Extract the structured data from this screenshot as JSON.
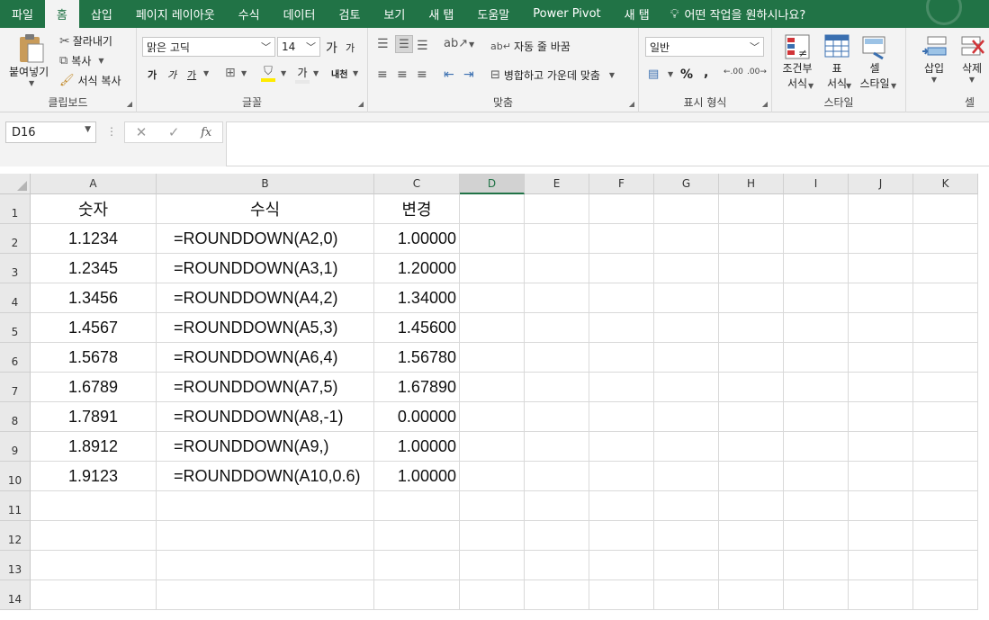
{
  "menu": {
    "tabs": [
      "파일",
      "홈",
      "삽입",
      "페이지 레이아웃",
      "수식",
      "데이터",
      "검토",
      "보기",
      "새 탭",
      "도움말",
      "Power Pivot",
      "새 탭"
    ],
    "active_index": 1,
    "tell_me": "어떤 작업을 원하시나요?"
  },
  "ribbon": {
    "clipboard": {
      "paste": "붙여넣기",
      "cut": "잘라내기",
      "copy": "복사",
      "format_painter": "서식 복사",
      "label": "클립보드"
    },
    "font": {
      "font_name": "맑은 고딕",
      "font_size": "14",
      "bold": "가",
      "italic": "가",
      "underline": "가",
      "font_color_glyph": "가",
      "phonetic": "내천",
      "grow": "가",
      "shrink": "가",
      "label": "글꼴"
    },
    "alignment": {
      "wrap_text": "자동 줄 바꿈",
      "merge_center": "병합하고 가운데 맞춤",
      "label": "맞춤"
    },
    "number": {
      "format": "일반",
      "percent": "%",
      "comma": ",",
      "label": "표시 형식"
    },
    "styles": {
      "conditional_line1": "조건부",
      "conditional_line2": "서식",
      "table_line1": "표",
      "table_line2": "서식",
      "cell_style_line1": "셀",
      "cell_style_line2": "스타일",
      "label": "스타일"
    },
    "cells": {
      "insert": "삽입",
      "delete": "삭제",
      "label": "셀"
    }
  },
  "formula_bar": {
    "name_box": "D16",
    "cancel": "✕",
    "enter": "✓",
    "fx": "fx",
    "formula": ""
  },
  "sheet": {
    "columns": [
      "A",
      "B",
      "C",
      "D",
      "E",
      "F",
      "G",
      "H",
      "I",
      "J",
      "K"
    ],
    "selected_column": "D",
    "row_numbers": [
      "1",
      "2",
      "3",
      "4",
      "5",
      "6",
      "7",
      "8",
      "9",
      "10",
      "11",
      "12",
      "13",
      "14"
    ],
    "header_row": [
      "숫자",
      "수식",
      "변경"
    ],
    "rows": [
      [
        "1.1234",
        "=ROUNDDOWN(A2,0)",
        "1.00000"
      ],
      [
        "1.2345",
        "=ROUNDDOWN(A3,1)",
        "1.20000"
      ],
      [
        "1.3456",
        "=ROUNDDOWN(A4,2)",
        "1.34000"
      ],
      [
        "1.4567",
        "=ROUNDDOWN(A5,3)",
        "1.45600"
      ],
      [
        "1.5678",
        "=ROUNDDOWN(A6,4)",
        "1.56780"
      ],
      [
        "1.6789",
        "=ROUNDDOWN(A7,5)",
        "1.67890"
      ],
      [
        "1.7891",
        "=ROUNDDOWN(A8,-1)",
        "0.00000"
      ],
      [
        "1.8912",
        "=ROUNDDOWN(A9,)",
        "1.00000"
      ],
      [
        "1.9123",
        "=ROUNDDOWN(A10,0.6)",
        "1.00000"
      ]
    ]
  },
  "colors": {
    "accent": "#217346",
    "ribbon_bg": "#f3f3f3",
    "header_bg": "#e9e9e9",
    "gridline": "#d9d9d9"
  },
  "icons": [
    "paste-icon",
    "cut-icon",
    "copy-icon",
    "format-painter-icon",
    "bold-icon",
    "italic-icon",
    "underline-icon",
    "border-icon",
    "fill-color-icon",
    "font-color-icon",
    "align-icons",
    "orientation-icon",
    "wrap-text-icon",
    "merge-center-icon",
    "accounting-icon",
    "conditional-format-icon",
    "format-table-icon",
    "cell-styles-icon",
    "insert-cells-icon",
    "delete-cells-icon",
    "lightbulb-icon"
  ]
}
